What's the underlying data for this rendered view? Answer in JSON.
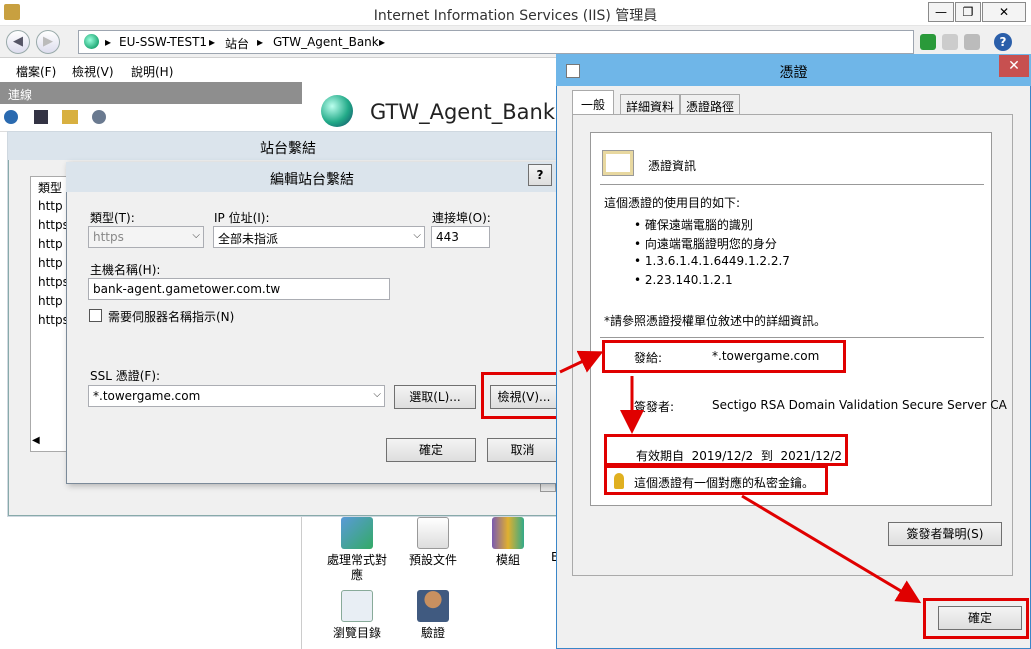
{
  "window": {
    "title": "Internet Information Services (IIS) 管理員",
    "controls": [
      "—",
      "❐",
      "✕"
    ]
  },
  "address": {
    "segments": [
      "EU-SSW-TEST1",
      "站台",
      "GTW_Agent_Bank"
    ]
  },
  "menu": [
    "檔案(F)",
    "檢視(V)",
    "說明(H)"
  ],
  "connections": {
    "title": "連線"
  },
  "home": {
    "title": "GTW_Agent_Bank 首",
    "features": [
      {
        "label": "處理常式對應"
      },
      {
        "label": "預設文件"
      },
      {
        "label": "模組"
      },
      {
        "label": "瀏覽目錄"
      },
      {
        "label": "驗證"
      }
    ],
    "edge_glyph": "B"
  },
  "site_bindings": {
    "title": "站台繫結",
    "list_header": "類型",
    "rows": [
      "http",
      "https",
      "http",
      "http",
      "https",
      "http",
      "https"
    ]
  },
  "edit_binding": {
    "title": "編輯站台繫結",
    "help": "?",
    "type_label": "類型(T):",
    "type_value": "https",
    "ip_label": "IP 位址(I):",
    "ip_value": "全部未指派",
    "port_label": "連接埠(O):",
    "port_value": "443",
    "host_label": "主機名稱(H):",
    "host_value": "bank-agent.gametower.com.tw",
    "sni_label": "需要伺服器名稱指示(N)",
    "ssl_label": "SSL 憑證(F):",
    "ssl_value": "*.towergame.com",
    "select_button": "選取(L)...",
    "view_button": "檢視(V)...",
    "ok_button": "確定",
    "cancel_button": "取消"
  },
  "certificate": {
    "title": "憑證",
    "tabs": [
      "一般",
      "詳細資料",
      "憑證路徑"
    ],
    "info_heading": "憑證資訊",
    "purposes_heading": "這個憑證的使用目的如下:",
    "purposes": [
      "確保遠端電腦的識別",
      "向遠端電腦證明您的身分",
      "1.3.6.1.4.1.6449.1.2.2.7",
      "2.23.140.1.2.1"
    ],
    "note": "*請參照憑證授權單位敘述中的詳細資訊。",
    "issued_to_label": "發給:",
    "issued_to": "*.towergame.com",
    "issued_by_label": "簽發者:",
    "issued_by": "Sectigo RSA Domain Validation Secure Server CA",
    "valid_from_label": "有效期自",
    "valid_from": "2019/12/2",
    "valid_to_label": "到",
    "valid_to": "2021/12/2",
    "private_key_note": "這個憑證有一個對應的私密金鑰。",
    "issuer_statement_button": "簽發者聲明(S)",
    "ok_button": "確定"
  },
  "colors": {
    "highlight": "#e00000",
    "cert_title": "#6fb6e8"
  }
}
